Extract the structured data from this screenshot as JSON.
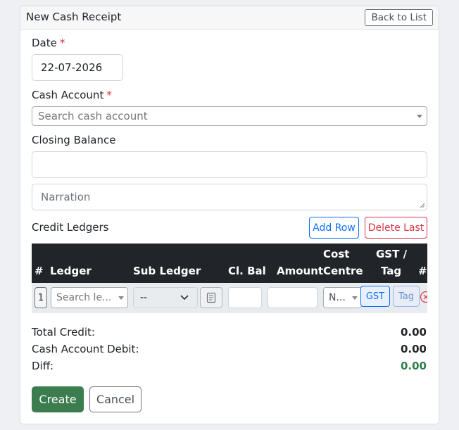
{
  "header": {
    "title": "New Cash Receipt",
    "back_label": "Back to List"
  },
  "form": {
    "date_label": "Date",
    "required_mark": "*",
    "date_value": "22-07-2026",
    "cash_account_label": "Cash Account",
    "cash_account_placeholder": "Search cash account",
    "closing_balance_label": "Closing Balance",
    "closing_balance_value": "",
    "narration_placeholder": "Narration"
  },
  "credit": {
    "title": "Credit Ledgers",
    "add_row_label": "Add Row",
    "delete_last_label": "Delete Last"
  },
  "table": {
    "headers": {
      "num": "#",
      "ledger": "Ledger",
      "sub_ledger": "Sub Ledger",
      "cl_bal": "Cl. Bal",
      "amount": "Amount",
      "cost_line1": "Cost",
      "cost_line2": "Centre",
      "gst_line1": "GST /",
      "gst_line2": "Tag",
      "hash": "#"
    },
    "row": {
      "index": "1",
      "ledger_placeholder": "Search le...",
      "sub_ledger_value": "--",
      "cost_centre_value": "N...",
      "gst_label": "GST",
      "tag_label": "Tag"
    }
  },
  "totals": {
    "total_credit_label": "Total Credit:",
    "total_credit_value": "0.00",
    "cash_debit_label": "Cash Account Debit:",
    "cash_debit_value": "0.00",
    "diff_label": "Diff:",
    "diff_value": "0.00",
    "diff_color": "#2f7d4a"
  },
  "actions": {
    "create_label": "Create",
    "cancel_label": "Cancel"
  },
  "colors": {
    "primary": "#0d6efd",
    "danger": "#dc3545",
    "success": "#3b7d4f",
    "table_header": "#212529"
  }
}
